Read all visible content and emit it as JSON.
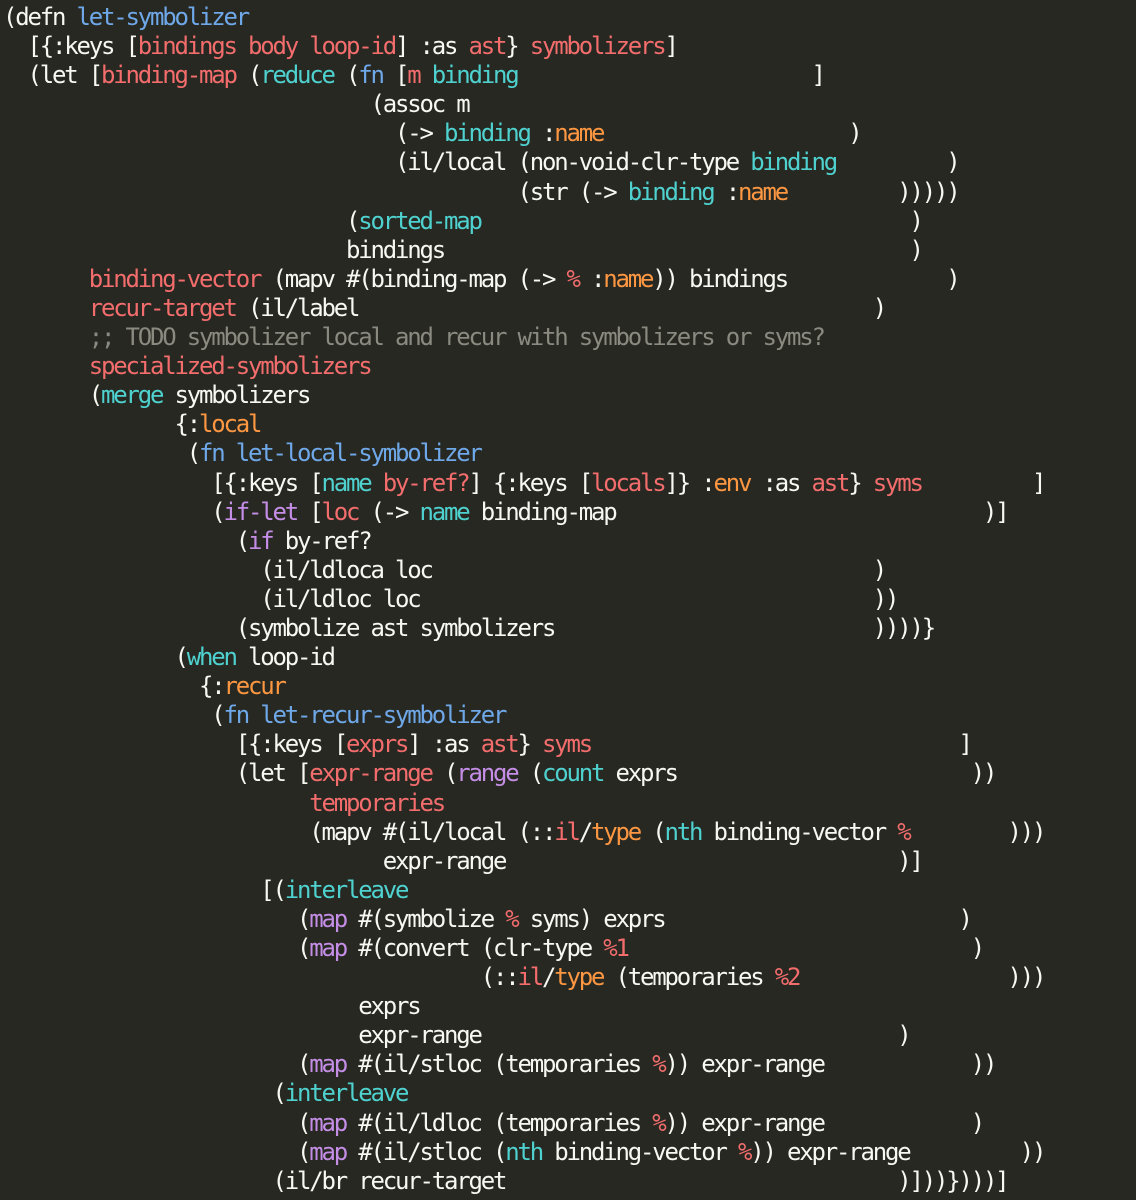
{
  "editor": {
    "language": "clojure",
    "theme": {
      "background": "#272822",
      "text": "#f8f8f2",
      "red": "#f36d6d",
      "blue": "#6fa8e8",
      "cyan": "#4fd2cf",
      "orange": "#fd9742",
      "purple": "#c58ee6",
      "comment": "#8a8a80"
    },
    "lines": [
      [
        [
          "text",
          "(defn "
        ],
        [
          "blue",
          "let-symbolizer"
        ]
      ],
      [
        [
          "text",
          "  [{:keys ["
        ],
        [
          "red",
          "bindings body loop-id"
        ],
        [
          "text",
          "] :as "
        ],
        [
          "red",
          "ast"
        ],
        [
          "text",
          "} "
        ],
        [
          "red",
          "symbolizers"
        ],
        [
          "text",
          "]"
        ]
      ],
      [
        [
          "text",
          "  (let ["
        ],
        [
          "red",
          "binding-map"
        ],
        [
          "text",
          " ("
        ],
        [
          "cyan",
          "reduce"
        ],
        [
          "text",
          " ("
        ],
        [
          "blue",
          "fn"
        ],
        [
          "text",
          " ["
        ],
        [
          "red",
          "m"
        ],
        [
          "text",
          " "
        ],
        [
          "cyan",
          "binding"
        ],
        [
          "text",
          "                        ]"
        ]
      ],
      [
        [
          "text",
          "                              (assoc m"
        ]
      ],
      [
        [
          "text",
          "                                (-> "
        ],
        [
          "cyan",
          "binding"
        ],
        [
          "text",
          " :"
        ],
        [
          "orange",
          "name"
        ],
        [
          "text",
          "                    )"
        ]
      ],
      [
        [
          "text",
          "                                (il/local (non-void-clr-type "
        ],
        [
          "cyan",
          "binding"
        ],
        [
          "text",
          "         )"
        ]
      ],
      [
        [
          "text",
          "                                          (str (-> "
        ],
        [
          "cyan",
          "binding"
        ],
        [
          "text",
          " :"
        ],
        [
          "orange",
          "name"
        ],
        [
          "text",
          "         )))))"
        ]
      ],
      [
        [
          "text",
          "                            ("
        ],
        [
          "cyan",
          "sorted-map"
        ],
        [
          "text",
          "                                   )"
        ]
      ],
      [
        [
          "text",
          "                            bindings                                      )"
        ]
      ],
      [
        [
          "text",
          "       "
        ],
        [
          "red",
          "binding-vector"
        ],
        [
          "text",
          " (mapv #(binding-map (-> "
        ],
        [
          "red",
          "%"
        ],
        [
          "text",
          " :"
        ],
        [
          "orange",
          "name"
        ],
        [
          "text",
          ")) bindings             )"
        ]
      ],
      [
        [
          "text",
          "       "
        ],
        [
          "red",
          "recur-target"
        ],
        [
          "text",
          " (il/label                                          )"
        ]
      ],
      [
        [
          "comment",
          "       ;; TODO symbolizer local and recur with symbolizers or syms?"
        ]
      ],
      [
        [
          "text",
          "       "
        ],
        [
          "red",
          "specialized-symbolizers"
        ]
      ],
      [
        [
          "text",
          "       ("
        ],
        [
          "cyan",
          "merge"
        ],
        [
          "text",
          " symbolizers"
        ]
      ],
      [
        [
          "text",
          "              {:"
        ],
        [
          "orange",
          "local"
        ]
      ],
      [
        [
          "text",
          "               ("
        ],
        [
          "blue",
          "fn"
        ],
        [
          "text",
          " "
        ],
        [
          "blue",
          "let-local-symbolizer"
        ]
      ],
      [
        [
          "text",
          "                 [{:keys ["
        ],
        [
          "cyan",
          "name"
        ],
        [
          "text",
          " "
        ],
        [
          "red",
          "by-ref?"
        ],
        [
          "text",
          "] {:keys ["
        ],
        [
          "red",
          "locals"
        ],
        [
          "text",
          "]} :"
        ],
        [
          "orange",
          "env"
        ],
        [
          "text",
          " :as "
        ],
        [
          "red",
          "ast"
        ],
        [
          "text",
          "} "
        ],
        [
          "red",
          "syms"
        ],
        [
          "text",
          "         ]"
        ]
      ],
      [
        [
          "text",
          "                 ("
        ],
        [
          "purple",
          "if-let"
        ],
        [
          "text",
          " ["
        ],
        [
          "red",
          "loc"
        ],
        [
          "text",
          " (-> "
        ],
        [
          "cyan",
          "name"
        ],
        [
          "text",
          " binding-map                              )]"
        ]
      ],
      [
        [
          "text",
          "                   ("
        ],
        [
          "purple",
          "if"
        ],
        [
          "text",
          " by-ref?"
        ]
      ],
      [
        [
          "text",
          "                     (il/ldloca loc                                    )"
        ]
      ],
      [
        [
          "text",
          "                     (il/ldloc loc                                     ))"
        ]
      ],
      [
        [
          "text",
          "                   (symbolize ast symbolizers                          ))))}"
        ]
      ],
      [
        [
          "text",
          "              ("
        ],
        [
          "cyan",
          "when"
        ],
        [
          "text",
          " loop-id"
        ]
      ],
      [
        [
          "text",
          "                {:"
        ],
        [
          "orange",
          "recur"
        ]
      ],
      [
        [
          "text",
          "                 ("
        ],
        [
          "blue",
          "fn"
        ],
        [
          "text",
          " "
        ],
        [
          "blue",
          "let-recur-symbolizer"
        ]
      ],
      [
        [
          "text",
          "                   [{:keys ["
        ],
        [
          "red",
          "exprs"
        ],
        [
          "text",
          "] :as "
        ],
        [
          "red",
          "ast"
        ],
        [
          "text",
          "} "
        ],
        [
          "red",
          "syms"
        ],
        [
          "text",
          "                              ]"
        ]
      ],
      [
        [
          "text",
          "                   (let ["
        ],
        [
          "red",
          "expr-range"
        ],
        [
          "text",
          " ("
        ],
        [
          "purple",
          "range"
        ],
        [
          "text",
          " ("
        ],
        [
          "cyan",
          "count"
        ],
        [
          "text",
          " exprs                        ))"
        ]
      ],
      [
        [
          "text",
          "                         "
        ],
        [
          "red",
          "temporaries"
        ]
      ],
      [
        [
          "text",
          "                         (mapv #(il/local (::"
        ],
        [
          "red",
          "il"
        ],
        [
          "text",
          "/"
        ],
        [
          "orange",
          "type"
        ],
        [
          "text",
          " ("
        ],
        [
          "cyan",
          "nth"
        ],
        [
          "text",
          " binding-vector "
        ],
        [
          "red",
          "%"
        ],
        [
          "text",
          "        )))"
        ]
      ],
      [
        [
          "text",
          "                               expr-range                                )]"
        ]
      ],
      [
        [
          "text",
          "                     [("
        ],
        [
          "cyan",
          "interleave"
        ]
      ],
      [
        [
          "text",
          "                        ("
        ],
        [
          "purple",
          "map"
        ],
        [
          "text",
          " #(symbolize "
        ],
        [
          "red",
          "%"
        ],
        [
          "text",
          " syms) exprs                        )"
        ]
      ],
      [
        [
          "text",
          "                        ("
        ],
        [
          "purple",
          "map"
        ],
        [
          "text",
          " #(convert (clr-type "
        ],
        [
          "red",
          "%1"
        ],
        [
          "text",
          "                            )"
        ]
      ],
      [
        [
          "text",
          "                                       (::"
        ],
        [
          "red",
          "il"
        ],
        [
          "text",
          "/"
        ],
        [
          "orange",
          "type"
        ],
        [
          "text",
          " (temporaries "
        ],
        [
          "red",
          "%2"
        ],
        [
          "text",
          "                 )))"
        ]
      ],
      [
        [
          "text",
          "                             exprs"
        ]
      ],
      [
        [
          "text",
          "                             expr-range                                  )"
        ]
      ],
      [
        [
          "text",
          "                        ("
        ],
        [
          "purple",
          "map"
        ],
        [
          "text",
          " #(il/stloc (temporaries "
        ],
        [
          "red",
          "%"
        ],
        [
          "text",
          ")) expr-range            ))"
        ]
      ],
      [
        [
          "text",
          "                      ("
        ],
        [
          "cyan",
          "interleave"
        ]
      ],
      [
        [
          "text",
          "                        ("
        ],
        [
          "purple",
          "map"
        ],
        [
          "text",
          " #(il/ldloc (temporaries "
        ],
        [
          "red",
          "%"
        ],
        [
          "text",
          ")) expr-range            )"
        ]
      ],
      [
        [
          "text",
          "                        ("
        ],
        [
          "purple",
          "map"
        ],
        [
          "text",
          " #(il/stloc ("
        ],
        [
          "cyan",
          "nth"
        ],
        [
          "text",
          " binding-vector "
        ],
        [
          "red",
          "%"
        ],
        [
          "text",
          ")) expr-range         ))"
        ]
      ],
      [
        [
          "text",
          "                      (il/br recur-target                                )]))})))]"
        ]
      ]
    ]
  }
}
